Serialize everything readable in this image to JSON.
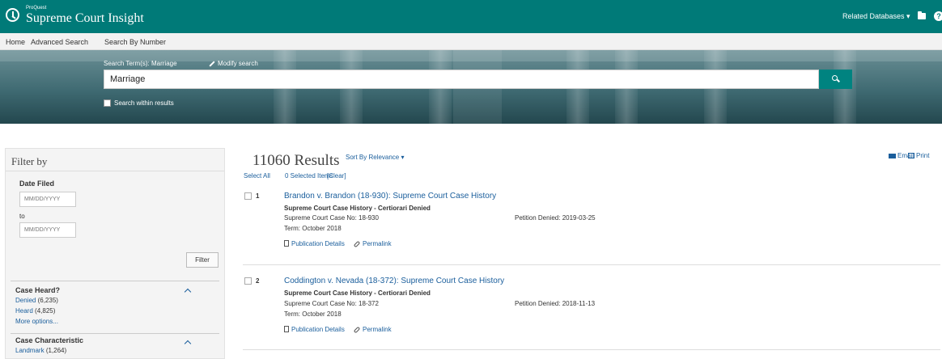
{
  "header": {
    "brand_small": "ProQuest",
    "brand_main": "Supreme Court Insight",
    "related_databases": "Related Databases ▾"
  },
  "nav": {
    "home": "Home",
    "advanced_search": "Advanced Search",
    "search_by_number": "Search By Number"
  },
  "search": {
    "term_label": "Search Term(s): Marriage",
    "modify_label": "Modify search",
    "value": "Marriage",
    "within_label": "Search within results"
  },
  "filter": {
    "title": "Filter by",
    "date_filed": "Date Filed",
    "date_placeholder": "MM/DD/YYYY",
    "to": "to",
    "filter_button": "Filter",
    "facets": [
      {
        "title": "Case Heard?",
        "options": [
          {
            "label": "Denied",
            "count": "(6,235)"
          },
          {
            "label": "Heard",
            "count": "(4,825)"
          }
        ],
        "more": "More options..."
      },
      {
        "title": "Case Characteristic",
        "options": [
          {
            "label": "Landmark",
            "count": "(1,264)"
          }
        ]
      }
    ]
  },
  "results": {
    "count": "11060 Results",
    "sort": "Sort By Relevance ▾",
    "email": "Email",
    "print": "Print",
    "select_all": "Select All",
    "selected_items": "0 Selected Items",
    "clear": "[Clear]",
    "items": [
      {
        "num": "1",
        "title": "Brandon v. Brandon (18-930): Supreme Court Case History",
        "type": "Supreme Court Case History - Certiorari Denied",
        "case_no": "Supreme Court Case No: 18-930",
        "term": "Term: October 2018",
        "petition": "Petition Denied: 2019-03-25",
        "pub_details": "Publication Details",
        "permalink": "Permalink"
      },
      {
        "num": "2",
        "title": "Coddington v. Nevada (18-372): Supreme Court Case History",
        "type": "Supreme Court Case History - Certiorari Denied",
        "case_no": "Supreme Court Case No: 18-372",
        "term": "Term: October 2018",
        "petition": "Petition Denied: 2018-11-13",
        "pub_details": "Publication Details",
        "permalink": "Permalink"
      }
    ]
  },
  "colors": {
    "header_teal": "#007a78",
    "link_blue": "#1a5e9c"
  }
}
